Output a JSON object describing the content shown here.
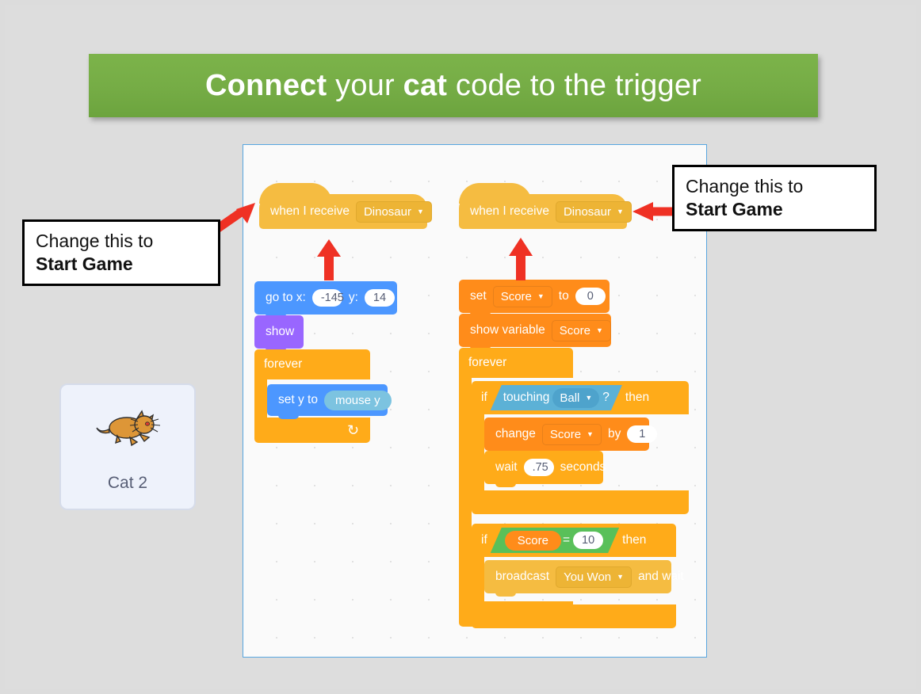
{
  "slide": {
    "title_part1": "Connect",
    "title_part2": " your ",
    "title_part3": "cat",
    "title_part4": " code to the trigger",
    "background_color": "#dcdcdc",
    "banner_color": "#76ad46"
  },
  "callouts": [
    {
      "name": "left-callout",
      "line1": "Change this to",
      "line2": "Start Game"
    },
    {
      "name": "right-callout",
      "line1": "Change this to",
      "line2": "Start Game"
    }
  ],
  "sprite": {
    "label": "Cat 2",
    "icon": "cat-sprite-icon"
  },
  "workspace": {
    "border_color": "#58a6e0",
    "background_color": "#fafafa"
  },
  "scripts": {
    "left": {
      "hat": {
        "text": "when I receive",
        "dropdown": "Dinosaur"
      },
      "goto": {
        "label": "go to x:",
        "x_value": "-145",
        "y_label": "y:",
        "y_value": "14"
      },
      "show": {
        "label": "show"
      },
      "forever": {
        "label": "forever"
      },
      "set_y": {
        "label": "set y to",
        "reporter": "mouse y"
      }
    },
    "right": {
      "hat": {
        "text": "when I receive",
        "dropdown": "Dinosaur"
      },
      "set_score": {
        "label": "set",
        "variable": "Score",
        "to_label": "to",
        "value": "0"
      },
      "show_variable": {
        "label": "show variable",
        "variable": "Score"
      },
      "forever": {
        "label": "forever"
      },
      "if_touching": {
        "if_label": "if",
        "condition": "touching",
        "target": "Ball",
        "question": "?",
        "then_label": "then"
      },
      "change_score": {
        "label": "change",
        "variable": "Score",
        "by_label": "by",
        "value": "1"
      },
      "wait": {
        "label": "wait",
        "value": ".75",
        "unit_label": "seconds"
      },
      "if_score": {
        "if_label": "if",
        "variable": "Score",
        "operator": "=",
        "value": "10",
        "then_label": "then"
      },
      "broadcast": {
        "label": "broadcast",
        "message": "You Won",
        "suffix": "and wait"
      }
    }
  },
  "colors": {
    "events": "#f5bc41",
    "motion": "#4c97ff",
    "looks": "#9966ff",
    "control": "#ffab19",
    "variables": "#ff8c1a",
    "sensing": "#5cb1d6",
    "operators": "#59c059",
    "arrow_red": "#e8291c"
  }
}
